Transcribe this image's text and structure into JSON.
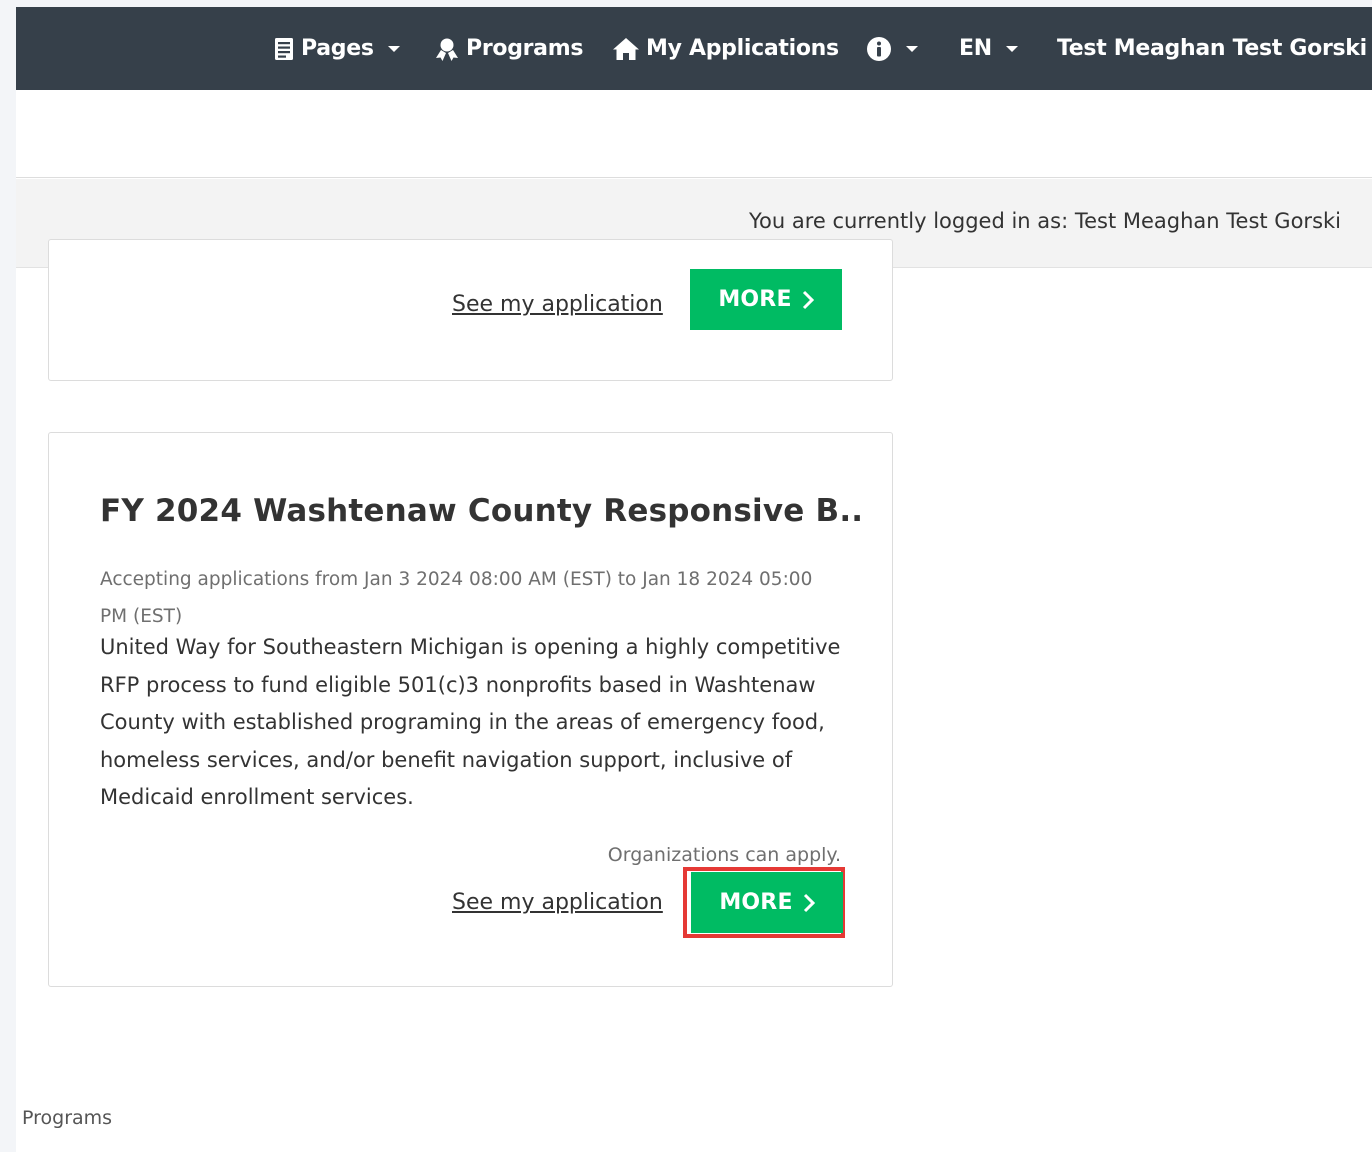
{
  "navbar": {
    "pages_label": "Pages",
    "programs_label": "Programs",
    "my_applications_label": "My Applications",
    "language_label": "EN",
    "user_label": "Test Meaghan Test Gorski"
  },
  "banner": {
    "login_text": "You are currently logged in as: Test Meaghan Test Gorski"
  },
  "cards": [
    {
      "see_application_label": "See my application",
      "more_label": "MORE"
    },
    {
      "title": "FY 2024 Washtenaw County Responsive B...",
      "dates": "Accepting applications from Jan 3 2024 08:00 AM (EST) to Jan 18 2024 05:00 PM (EST)",
      "description": "United Way for Southeastern Michigan is opening a highly competitive RFP process to fund eligible 501(c)3 nonprofits based in Washtenaw County with established programing in the areas of emergency food, homeless services, and/or benefit navigation support, inclusive of Medicaid enrollment services.",
      "eligibility": "Organizations can apply.",
      "see_application_label": "See my application",
      "more_label": "MORE"
    }
  ],
  "footer": {
    "programs_label": "Programs"
  },
  "colors": {
    "navbar_bg": "#36404a",
    "more_button_bg": "#00bb63",
    "highlight": "#e53935"
  },
  "icons": [
    "pages-icon",
    "programs-icon",
    "home-icon",
    "info-icon",
    "chevron-right-icon",
    "caret-down-icon"
  ]
}
